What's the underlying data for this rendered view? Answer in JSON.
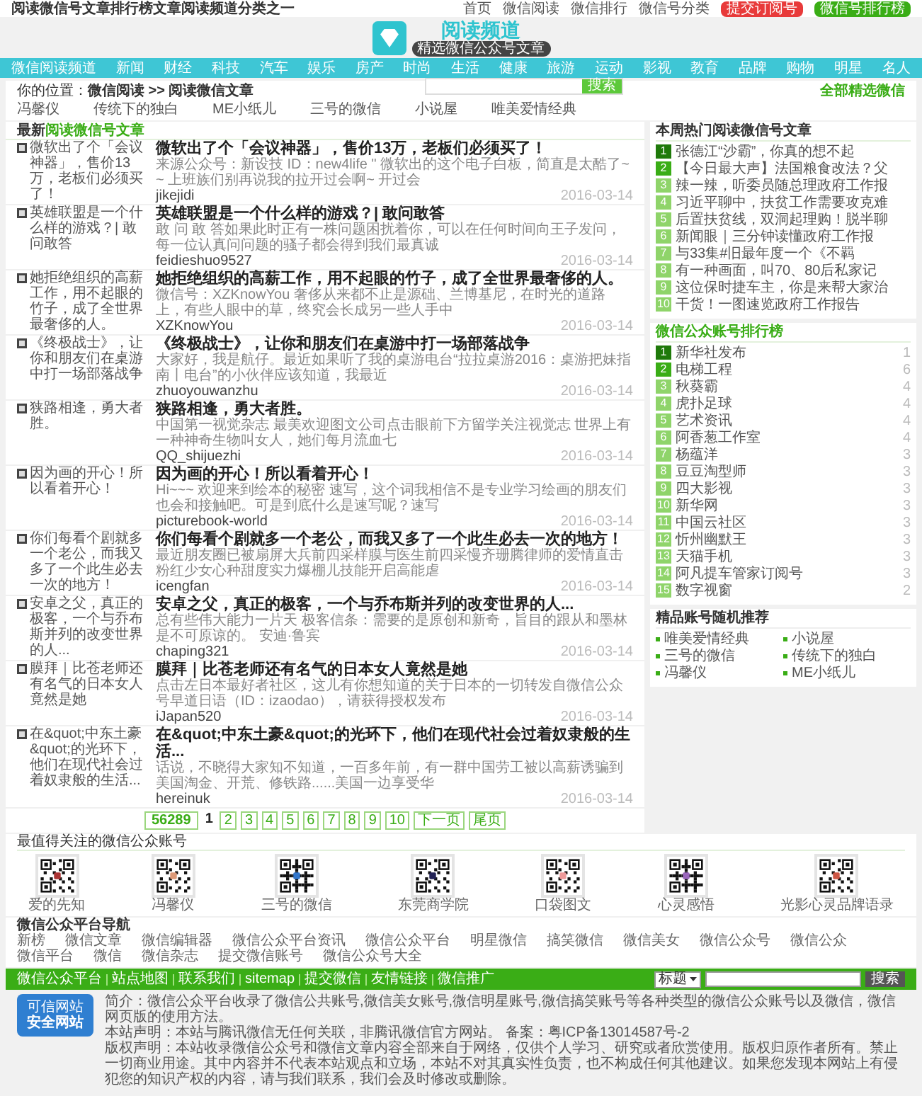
{
  "top_bar": {
    "tagline": "阅读微信号文章排行榜文章阅读频道分类之一",
    "links": [
      "首页",
      "微信阅读",
      "微信排行",
      "微信号分类"
    ],
    "buttons": [
      {
        "label": "提交订阅号",
        "kind": "red"
      },
      {
        "label": "微信号排行榜",
        "kind": "green"
      }
    ]
  },
  "logo": {
    "title": "阅读频道",
    "subtitle": "精选微信公众号文章"
  },
  "nav": [
    "微信阅读频道",
    "新闻",
    "财经",
    "科技",
    "汽车",
    "娱乐",
    "房产",
    "时尚",
    "生活",
    "健康",
    "旅游",
    "运动",
    "影视",
    "教育",
    "品牌",
    "购物",
    "明星",
    "名人"
  ],
  "search_popup": {
    "button": "搜索"
  },
  "breadcrumb": {
    "prefix": "你的位置：",
    "path": "微信阅读 >> 阅读微信文章",
    "right_link": "全部精选微信"
  },
  "tags": [
    "冯馨仪",
    "传统下的独白",
    "ME小纸儿",
    "三号的微信",
    "小说屋",
    "唯美爱情经典"
  ],
  "articles_section": {
    "title_plain": "最新",
    "title_accent": "阅读微信号文章"
  },
  "articles": [
    {
      "caption": "微软出了个「会议神器」，售价13万，老板们必须买了！",
      "title": "微软出了个「会议神器」，售价13万，老板们必须买了！",
      "desc": "来源公众号：新设技 ID：new4life \" 微软出的这个电子白板，简直是太酷了~~ 上班族们别再说我的拉开过会啊~ 开过会",
      "author": "jikejidi",
      "date": "2016-03-14"
    },
    {
      "caption": "英雄联盟是一个什么样的游戏？| 敢问敢答",
      "title": "英雄联盟是一个什么样的游戏？| 敢问敢答",
      "desc": "敢 问 敢 答如果此时正有一株问题困扰着你，可以在任何时间向王子发问，每一位认真问问题的骚子都会得到我们最真诚",
      "author": "feidieshuo9527",
      "date": "2016-03-14"
    },
    {
      "caption": "她拒绝组织的高薪工作，用不起眼的竹子，成了全世界最奢侈的人。",
      "title": "她拒绝组织的高薪工作，用不起眼的竹子，成了全世界最奢侈的人。",
      "desc": "微信号：XZKnowYou 奢侈从来都不止是源础、兰博基尼，在时光的道路上，有些人眼中的草，终究会长成另一些人手中",
      "author": "XZKnowYou",
      "date": "2016-03-14"
    },
    {
      "caption": "《终极战士》，让你和朋友们在桌游中打一场部落战争",
      "title": "《终极战士》，让你和朋友们在桌游中打一场部落战争",
      "desc": "大家好，我是航仔。最近如果听了我的桌游电台“拉拉桌游2016：桌游把妹指南丨电台”的小伙伴应该知道，我最近",
      "author": "zhuoyouwanzhu",
      "date": "2016-03-14"
    },
    {
      "caption": "狭路相逢，勇大者胜。",
      "title": "狭路相逢，勇大者胜。",
      "desc": "中国第一视觉杂志 最美欢迎图文公司点击眼前下方留学关注视觉志 世界上有一种神奇生物叫女人，她们每月流血七",
      "author": "QQ_shijuezhi",
      "date": "2016-03-14"
    },
    {
      "caption": "因为画的开心！所以看着开心！",
      "title": "因为画的开心！所以看着开心！",
      "desc": "Hi~~~ 欢迎来到绘本的秘密 速写，这个词我相信不是专业学习绘画的朋友们也会和接触吧。可是到底什么是速写呢？速写",
      "author": "picturebook-world",
      "date": "2016-03-14"
    },
    {
      "caption": "你们每看个剧就多一个老公，而我又多了一个此生必去一次的地方！",
      "title": "你们每看个剧就多一个老公，而我又多了一个此生必去一次的地方！",
      "desc": "最近朋友圈已被扇屏大兵前四采样膜与医生前四采慢齐珊腾律师的爱情直击粉红少女心种甜度实力爆棚儿技能开启高能虐",
      "author": "icengfan",
      "date": "2016-03-14"
    },
    {
      "caption": "安卓之父，真正的极客，一个与乔布斯并列的改变世界的人...",
      "title": "安卓之父，真正的极客，一个与乔布斯并列的改变世界的人...",
      "desc": "总有些伟大能力一片天 极客信条：需要的是原创和新奇，旨目的跟从和墨林是不可原谅的。 安迪·鲁宾",
      "author": "chaping321",
      "date": "2016-03-14"
    },
    {
      "caption": "膜拜｜比苍老师还有名气的日本女人竟然是她",
      "title": "膜拜｜比苍老师还有名气的日本女人竟然是她",
      "desc": "点击左日本最好者社区，这儿有你想知道的关于日本的一切转发自微信公众号早道日语（ID：izaodao），请获得授权发布",
      "author": "iJapan520",
      "date": "2016-03-14"
    },
    {
      "caption": "在&quot;中东土豪&quot;的光环下，他们在现代社会过着奴隶般的生活...",
      "title": "在&quot;中东土豪&quot;的光环下，他们在现代社会过着奴隶般的生活...",
      "desc": "话说，不晓得大家知不知道，一百多年前，有一群中国劳工被以高薪诱骗到美国淘金、开荒、修铁路......美国一边享受华",
      "author": "hereinuk",
      "date": "2016-03-14"
    }
  ],
  "pagination": {
    "total": "56289",
    "pages": [
      {
        "label": "1",
        "selected": true
      },
      {
        "label": "2",
        "selected": false
      },
      {
        "label": "3",
        "selected": false
      },
      {
        "label": "4",
        "selected": false
      },
      {
        "label": "5",
        "selected": false
      },
      {
        "label": "6",
        "selected": false
      },
      {
        "label": "7",
        "selected": false
      },
      {
        "label": "8",
        "selected": false
      },
      {
        "label": "9",
        "selected": false
      },
      {
        "label": "10",
        "selected": false
      }
    ],
    "next": "下一页",
    "last": "尾页"
  },
  "hot_articles": {
    "title": "本周热门阅读微信号文章",
    "items": [
      {
        "rank": "1",
        "text": "张德江“沙霸”，你真的想不起"
      },
      {
        "rank": "2",
        "text": "【今日最大声】法国粮食改法？父"
      },
      {
        "rank": "3",
        "text": "辣一辣，听委员随总理政府工作报"
      },
      {
        "rank": "4",
        "text": "习近平聊中，扶贫工作需要攻克难"
      },
      {
        "rank": "5",
        "text": "后置扶贫线，双洞起理购！脱半聊"
      },
      {
        "rank": "6",
        "text": "新闻眼｜三分钟读懂政府工作报"
      },
      {
        "rank": "7",
        "text": "与33集#旧最年度一个《不羁"
      },
      {
        "rank": "8",
        "text": "有一种画面，叫70、80后私家记"
      },
      {
        "rank": "9",
        "text": "这位保时捷车主，你是来帮大家治"
      },
      {
        "rank": "10",
        "text": "干货！一图速览政府工作报告"
      }
    ]
  },
  "ranking": {
    "title": "微信公众账号排行榜",
    "items": [
      {
        "rank": "1",
        "name": "新华社发布",
        "count": "1"
      },
      {
        "rank": "2",
        "name": "电梯工程",
        "count": "6"
      },
      {
        "rank": "3",
        "name": "秋葵霸",
        "count": "4"
      },
      {
        "rank": "4",
        "name": "虎扑足球",
        "count": "4"
      },
      {
        "rank": "5",
        "name": "艺术资讯",
        "count": "4"
      },
      {
        "rank": "6",
        "name": "阿香葱工作室",
        "count": "4"
      },
      {
        "rank": "7",
        "name": "杨蕴洋",
        "count": "3"
      },
      {
        "rank": "8",
        "name": "豆豆淘型师",
        "count": "3"
      },
      {
        "rank": "9",
        "name": "四大影视",
        "count": "3"
      },
      {
        "rank": "10",
        "name": "新华网",
        "count": "3"
      },
      {
        "rank": "11",
        "name": "中国云社区",
        "count": "3"
      },
      {
        "rank": "12",
        "name": "忻州幽默王",
        "count": "3"
      },
      {
        "rank": "13",
        "name": "天猫手机",
        "count": "3"
      },
      {
        "rank": "14",
        "name": "阿凡提车管家订阅号",
        "count": "3"
      },
      {
        "rank": "15",
        "name": "数字视窗",
        "count": "2"
      }
    ]
  },
  "recommended": {
    "title": "精品账号随机推荐",
    "items": [
      "唯美爱情经典",
      "小说屋",
      "三号的微信",
      "传统下的独白",
      "冯馨仪",
      "ME小纸儿"
    ]
  },
  "qr_section": {
    "title": "最值得关注的微信公众账号",
    "accounts": [
      "爱的先知",
      "冯馨仪",
      "三号的微信",
      "东莞商学院",
      "口袋图文",
      "心灵感悟",
      "光影心灵品牌语录"
    ]
  },
  "footer_nav": {
    "title": "微信公众平台导航",
    "links": [
      "新榜",
      "微信文章",
      "微信编辑器",
      "微信公众平台资讯",
      "微信公众平台",
      "明星微信",
      "搞笑微信",
      "微信美女",
      "微信公众号",
      "微信公众",
      "微信平台",
      "微信",
      "微信杂志",
      "提交微信账号",
      "微信公众号大全"
    ]
  },
  "footer_bar": {
    "links": [
      "微信公众平台",
      "站点地图",
      "联系我们",
      "sitemap",
      "提交微信",
      "友情链接",
      "微信推广"
    ],
    "search_type": "标题",
    "search_button": "搜索"
  },
  "badge": {
    "top": "可信网站",
    "bottom": "安全网站"
  },
  "footer_text": [
    "简介：微信公众平台收录了微信公共账号,微信美女账号,微信明星账号,微信搞笑账号等各种类型的微信公众账号以及微信，微信网页版的使用方法。",
    "本站声明：本站与腾讯微信无任何关联，非腾讯微信官方网站。 备案：粤ICP备13014587号-2",
    "版权声明：本站收录微信公众号和微信文章内容全部来自于网络，仅供个人学习、研究或者欣赏使用。版权归原作者所有。禁止一切商业用途。其中内容并不代表本站观点和立场，本站不对其真实性负责，也不构成任何其他建议。如果您发现本网站上有侵犯您的知识产权的内容，请与我们联系，我们会及时修改或删除。"
  ]
}
